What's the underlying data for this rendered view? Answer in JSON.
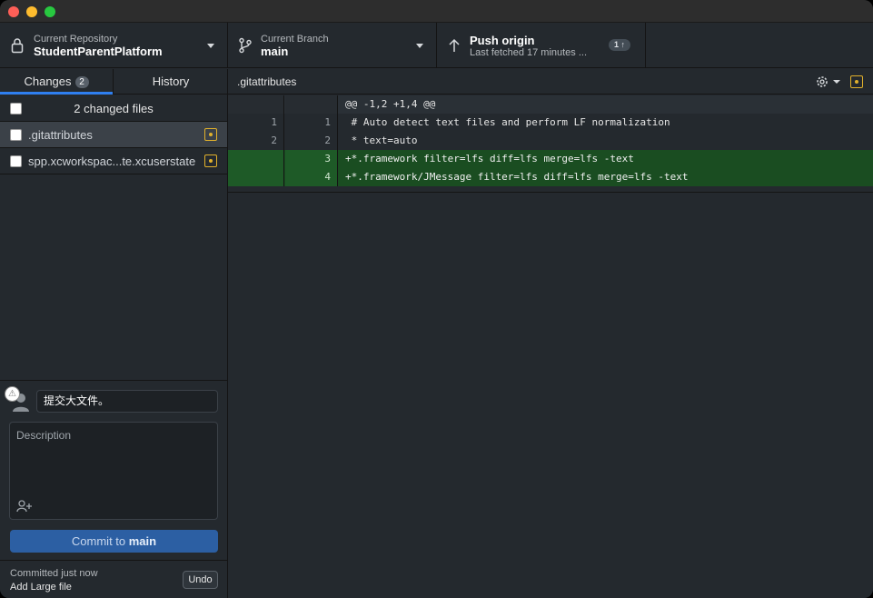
{
  "toolbar": {
    "repo": {
      "label": "Current Repository",
      "value": "StudentParentPlatform"
    },
    "branch": {
      "label": "Current Branch",
      "value": "main"
    },
    "push": {
      "title": "Push origin",
      "subtitle": "Last fetched 17 minutes ...",
      "badge": "1 ↑"
    }
  },
  "sidebar": {
    "tabs": [
      {
        "label": "Changes",
        "count": "2"
      },
      {
        "label": "History"
      }
    ],
    "changed_files_label": "2 changed files",
    "files": [
      {
        "name": ".gitattributes",
        "status": "modified"
      },
      {
        "name": "spp.xcworkspac...te.xcuserstate",
        "status": "modified"
      }
    ]
  },
  "commit": {
    "summary_value": "提交大文件。",
    "description_placeholder": "Description",
    "button_prefix": "Commit to ",
    "button_branch": "main"
  },
  "last_commit": {
    "time": "Committed just now",
    "message": "Add Large file",
    "undo_label": "Undo"
  },
  "diff": {
    "file_name": ".gitattributes",
    "rows": [
      {
        "kind": "hunk",
        "old": "",
        "new": "",
        "text": "@@ -1,2 +1,4 @@"
      },
      {
        "kind": "ctx",
        "old": "1",
        "new": "1",
        "text": " # Auto detect text files and perform LF normalization"
      },
      {
        "kind": "ctx",
        "old": "2",
        "new": "2",
        "text": " * text=auto"
      },
      {
        "kind": "add",
        "old": "",
        "new": "3",
        "text": "+*.framework filter=lfs diff=lfs merge=lfs -text"
      },
      {
        "kind": "add",
        "old": "",
        "new": "4",
        "text": "+*.framework/JMessage filter=lfs diff=lfs merge=lfs -text"
      }
    ]
  },
  "colors": {
    "accent": "#2f7ff0",
    "modified": "#e1b12c",
    "added_row": "#1a4d21"
  }
}
